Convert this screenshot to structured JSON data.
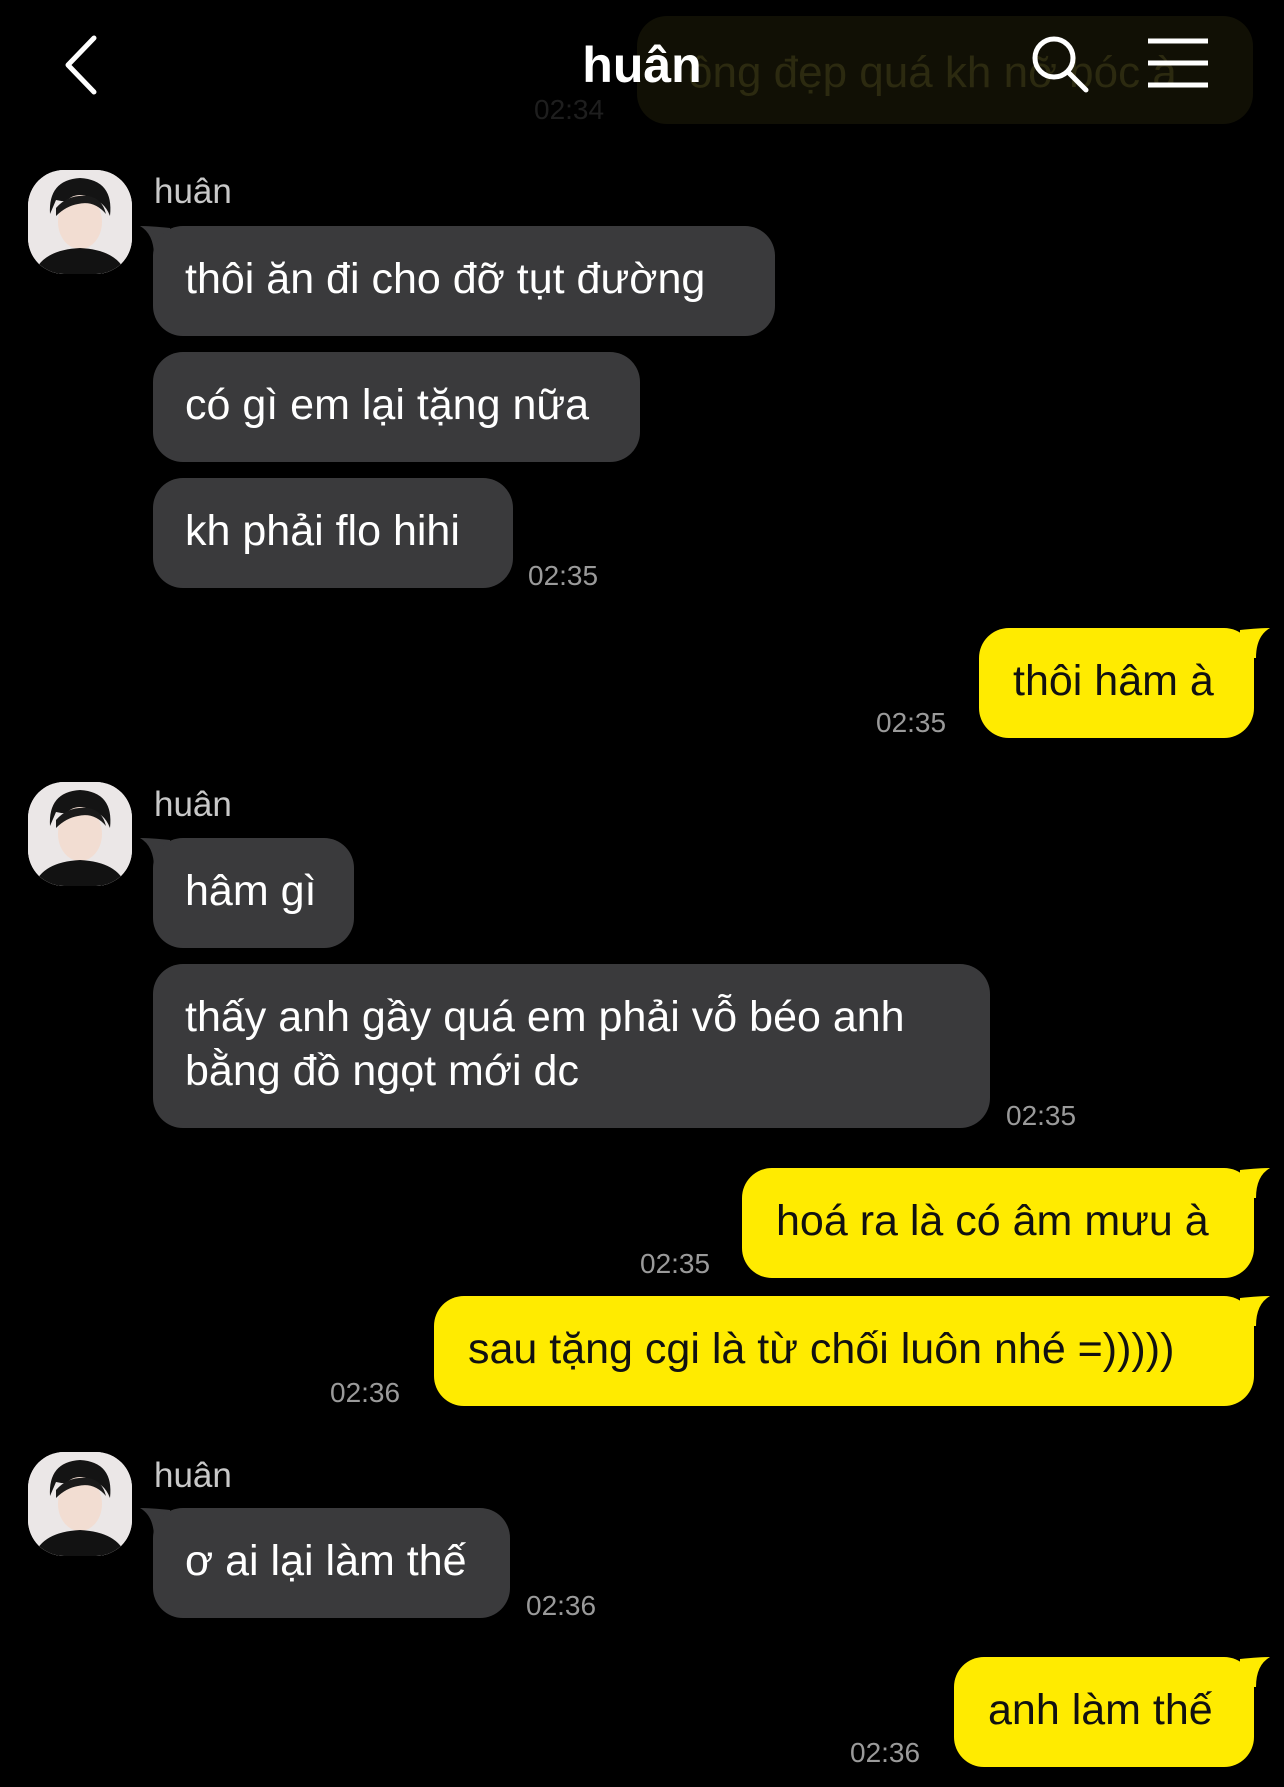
{
  "header": {
    "title": "huân",
    "back_icon": "chevron-left-icon",
    "search_icon": "search-icon",
    "menu_icon": "hamburger-menu-icon"
  },
  "faded_previous": {
    "text": "ông đẹp quá kh nỡ bóc à",
    "time": "02:34"
  },
  "colors": {
    "outgoing": "#ffeb00",
    "incoming": "#3a3a3c",
    "background": "#000000"
  },
  "groups": [
    {
      "sender": "huân",
      "messages": [
        "thôi ăn đi cho đỡ tụt đường",
        "có gì em lại tặng nữa",
        "kh phải flo hihi"
      ],
      "time": "02:35"
    },
    {
      "sender": "me",
      "messages": [
        "thôi hâm à"
      ],
      "time": "02:35"
    },
    {
      "sender": "huân",
      "messages": [
        "hâm gì",
        "thấy anh gầy quá em phải vỗ béo anh",
        "bằng đồ ngọt mới dc"
      ],
      "time": "02:35"
    },
    {
      "sender": "me",
      "messages": [
        "hoá ra là có âm mưu à"
      ],
      "time": "02:35"
    },
    {
      "sender": "me",
      "messages": [
        "sau tặng cgi là từ chối luôn nhé =)))))"
      ],
      "time": "02:36"
    },
    {
      "sender": "huân",
      "messages": [
        "ơ ai lại làm thế"
      ],
      "time": "02:36"
    },
    {
      "sender": "me",
      "messages": [
        "anh làm thế"
      ],
      "time": "02:36"
    }
  ]
}
